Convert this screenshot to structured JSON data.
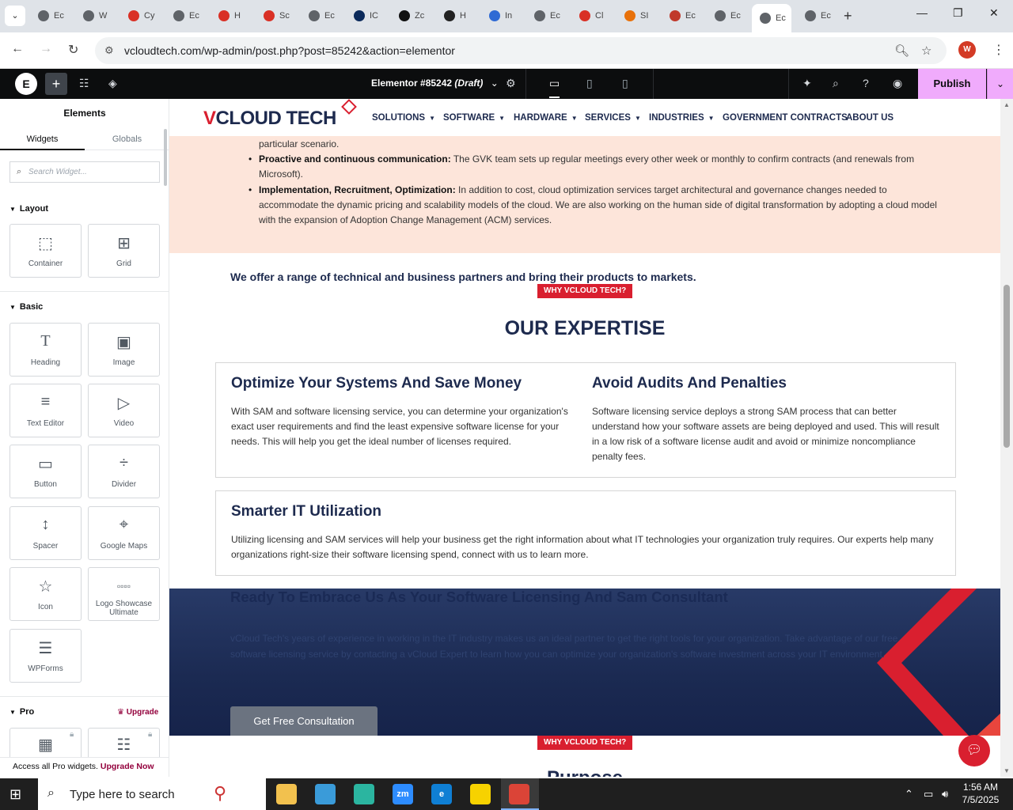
{
  "browser": {
    "tabs": [
      {
        "label": "Ec",
        "color": "#5f6368"
      },
      {
        "label": "W",
        "color": "#5f6368"
      },
      {
        "label": "Cy",
        "color": "#d93025"
      },
      {
        "label": "Ec",
        "color": "#5f6368"
      },
      {
        "label": "H",
        "color": "#d93025"
      },
      {
        "label": "Sc",
        "color": "#d93025"
      },
      {
        "label": "Ec",
        "color": "#5f6368"
      },
      {
        "label": "IC",
        "color": "#0b2a5b"
      },
      {
        "label": "Zc",
        "color": "#111111"
      },
      {
        "label": "H",
        "color": "#222222"
      },
      {
        "label": "In",
        "color": "#2f6ad4"
      },
      {
        "label": "Ec",
        "color": "#5f6368"
      },
      {
        "label": "Cl",
        "color": "#d93025"
      },
      {
        "label": "SI",
        "color": "#e8710a"
      },
      {
        "label": "Ec",
        "color": "#c0392b"
      },
      {
        "label": "Ec",
        "color": "#5f6368"
      },
      {
        "label": "Ec",
        "color": "#5f6368",
        "active": true
      },
      {
        "label": "Ec",
        "color": "#5f6368"
      }
    ],
    "url": "vcloudtech.com/wp-admin/post.php?post=85242&action=elementor",
    "profile_initial": "W"
  },
  "editor": {
    "document_title": "Elementor #85242",
    "document_status": "(Draft)",
    "publish_label": "Publish"
  },
  "panel": {
    "title": "Elements",
    "tabs": [
      "Widgets",
      "Globals"
    ],
    "search_placeholder": "Search Widget...",
    "categories": {
      "layout": "Layout",
      "basic": "Basic",
      "pro": "Pro"
    },
    "widgets": {
      "container": "Container",
      "grid": "Grid",
      "heading": "Heading",
      "image": "Image",
      "text_editor": "Text Editor",
      "video": "Video",
      "button": "Button",
      "divider": "Divider",
      "spacer": "Spacer",
      "google_maps": "Google Maps",
      "icon": "Icon",
      "logo_showcase": "Logo Showcase Ultimate",
      "wpforms": "WPForms"
    },
    "upgrade_label": "Upgrade",
    "pro_footer_text": "Access all Pro widgets.",
    "pro_footer_link": "Upgrade Now"
  },
  "site": {
    "logo_v": "V",
    "logo_rest": "CLOUD TECH",
    "menu": [
      {
        "label": "SOLUTIONS",
        "dropdown": true
      },
      {
        "label": "SOFTWARE",
        "dropdown": true
      },
      {
        "label": "HARDWARE",
        "dropdown": true
      },
      {
        "label": "SERVICES",
        "dropdown": true
      },
      {
        "label": "INDUSTRIES",
        "dropdown": true
      },
      {
        "label": "GOVERNMENT CONTRACTS",
        "dropdown": false
      },
      {
        "label": "ABOUT US",
        "dropdown": false
      }
    ],
    "bullet_fragment": "particular scenario.",
    "bullets": [
      {
        "bold": "Proactive and continuous communication:",
        "text": " The GVK team sets up regular meetings every other week or monthly to confirm contracts (and renewals from Microsoft)."
      },
      {
        "bold": "Implementation, Recruitment, Optimization:",
        "text": " In addition to cost, cloud optimization services target architectural and governance changes needed to accommodate the dynamic pricing and scalability models of the cloud. We are also working on the human side of digital transformation by adopting a cloud model with the expansion of Adoption Change Management (ACM) services."
      }
    ],
    "partners_line": "We offer a range of technical and business partners and bring their products to markets.",
    "why_pill": "WHY VCLOUD TECH?",
    "expertise_title": "OUR EXPERTISE",
    "cards": [
      {
        "title": "Optimize Your Systems And Save Money",
        "body": "With SAM and software licensing service, you can determine your organization's exact user requirements and find the least expensive software license for your needs. This will help you get the ideal number of licenses required."
      },
      {
        "title": "Avoid Audits And Penalties",
        "body": "Software licensing service deploys a strong SAM process that can better understand how your software assets are being deployed and used. This will result in a low risk of a software license audit and avoid or minimize noncompliance penalty fees."
      },
      {
        "title": "Smarter IT Utilization",
        "body": "Utilizing licensing and SAM services will help your business get the right information about what IT technologies your organization truly requires. Our experts help many organizations right-size their software licensing spend, connect with us to learn more."
      }
    ],
    "consult": {
      "title": "Ready To Embrace Us As Your Software Licensing And Sam Consultant",
      "body": "vCloud Tech's years of experience in working in the IT industry makes us an ideal partner to get the right tools for your organization. Take advantage of our free software licensing service by contacting a vCloud Expert to learn how you can optimize your organization's software investment across your IT environment.",
      "button": "Get Free Consultation"
    },
    "purpose_title": "Purpose"
  },
  "taskbar": {
    "search_placeholder": "Type here to search",
    "time": "1:56 AM",
    "date": "7/5/2025",
    "apps": [
      {
        "label": "",
        "color": "#f2c14e"
      },
      {
        "label": "",
        "color": "#3a9bd9"
      },
      {
        "label": "",
        "color": "#2bb5a0"
      },
      {
        "label": "zm",
        "color": "#2d8cff"
      },
      {
        "label": "e",
        "color": "#0f7fd4"
      },
      {
        "label": "",
        "color": "#f7d200"
      },
      {
        "label": "",
        "color": "#db4437"
      }
    ]
  },
  "colors": {
    "brand_red": "#d91f2f",
    "brand_navy": "#1d2a4e",
    "publish_pink": "#f0abfc",
    "peach": "#fde5da"
  }
}
